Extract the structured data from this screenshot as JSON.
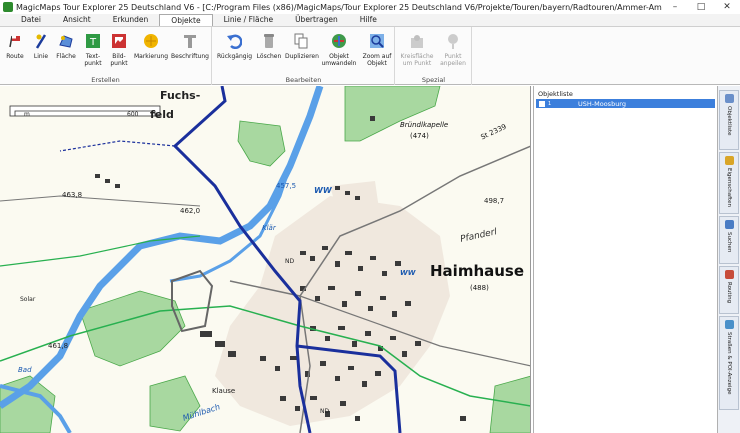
{
  "window": {
    "title": "MagicMaps Tour Explorer 25 Deutschland V6 - [C:/Program Files (x86)/MagicMaps/Tour Explorer 25 Deutschland V6/Projekte/Touren/bayern/Radtouren/Ammer-Amper Radweg.ikt]",
    "controls": [
      "–",
      "□",
      "✕"
    ]
  },
  "menu": {
    "tabs": [
      "Datei",
      "Ansicht",
      "Erkunden",
      "Objekte",
      "Linie / Fläche",
      "Übertragen",
      "Hilfe"
    ]
  },
  "ribbon": {
    "groups": [
      {
        "label": "Erstellen",
        "buttons": [
          {
            "label": "Route",
            "icon": "route-icon"
          },
          {
            "label": "Linie",
            "icon": "line-icon"
          },
          {
            "label": "Fläche",
            "icon": "area-icon"
          },
          {
            "label": "Text-\npunkt",
            "icon": "textpoint-icon"
          },
          {
            "label": "Bild-\npunkt",
            "icon": "imagepoint-icon"
          },
          {
            "label": "Markierung",
            "icon": "marker-icon"
          },
          {
            "label": "Beschriftung",
            "icon": "label-icon"
          }
        ]
      },
      {
        "label": "Bearbeiten",
        "buttons": [
          {
            "label": "Rückgängig",
            "icon": "undo-icon"
          },
          {
            "label": "Löschen",
            "icon": "trash-icon"
          },
          {
            "label": "Duplizieren",
            "icon": "duplicate-icon"
          },
          {
            "label": "Objekt\numwandeln",
            "icon": "convert-icon"
          },
          {
            "label": "Zoom auf\nObjekt",
            "icon": "zoom-icon"
          }
        ]
      },
      {
        "label": "Spezial",
        "buttons": [
          {
            "label": "Kreisfläche\num Punkt",
            "icon": "circle-area-icon"
          },
          {
            "label": "Punkt\nanpeilen",
            "icon": "target-point-icon"
          }
        ]
      }
    ]
  },
  "map": {
    "scale_m": "m",
    "scale_value": "600",
    "labels": [
      "Fuchs-",
      "feld",
      "Haimhause",
      "(488)",
      "Bründlkapelle",
      "(474)",
      "St 2339",
      "Pfanderl",
      "Klär",
      "WW",
      "WW",
      "457,5",
      "463,8",
      "462,0",
      "498,7",
      "461,8",
      "Solar",
      "Bad",
      "Klause",
      "Mühlbach",
      "ND",
      "ND"
    ]
  },
  "panel": {
    "title": "Objektliste",
    "items": [
      {
        "number": "1",
        "name": "USH-Moosburg"
      }
    ]
  },
  "sidetabs": [
    {
      "label": "Objektliste",
      "color": "#6a8fc9"
    },
    {
      "label": "Eigenschaften",
      "color": "#d9a527"
    },
    {
      "label": "Suchen",
      "color": "#4a7cc4"
    },
    {
      "label": "Routing",
      "color": "#c74c3a"
    },
    {
      "label": "Straßen & POI-Anzeige",
      "color": "#4a90c9"
    }
  ]
}
